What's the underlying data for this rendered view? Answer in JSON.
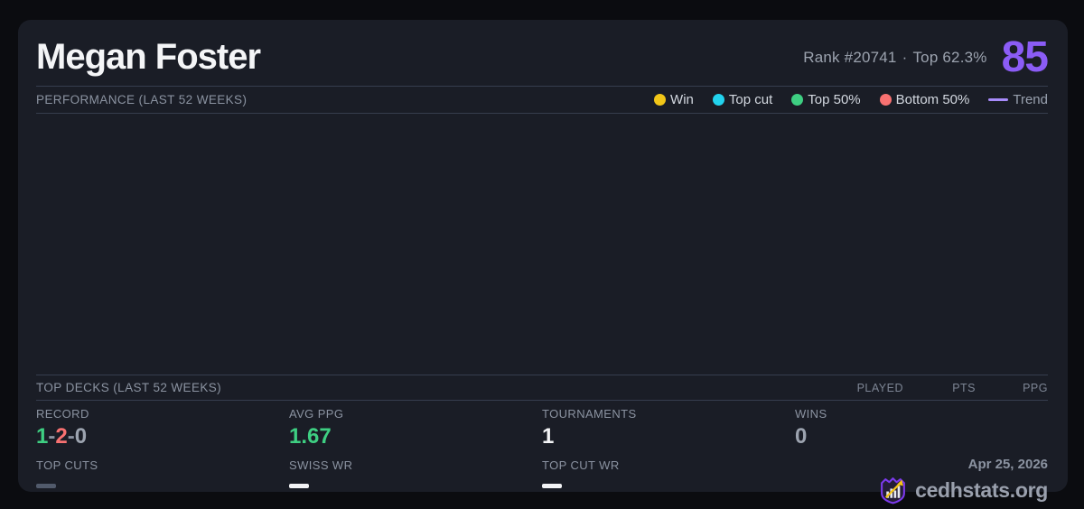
{
  "colors": {
    "page_bg": "#0b0c10",
    "card_bg": "#1a1d26",
    "divider": "#363d4e",
    "title_white": "#f4f5f7",
    "muted_grey": "#8b93a1",
    "score_purple": "#8b5cf6",
    "win_yellow": "#f2c618",
    "top_cut_cyan": "#22d3ee",
    "top50_green": "#3ecf82",
    "bottom50_red": "#f87171",
    "trend_purple": "#a78bfa",
    "value_grey": "#9ca3af",
    "logo_purple": "#7c3aed",
    "logo_gold": "#f5c518"
  },
  "header": {
    "player_name": "Megan Foster",
    "rank_text": "Rank #20741",
    "separator": "·",
    "percentile_text": "Top 62.3%",
    "score": "85"
  },
  "performance": {
    "title": "PERFORMANCE (LAST 52 WEEKS)",
    "legend": [
      {
        "label": "Win",
        "color": "#f2c618",
        "marker": "dot"
      },
      {
        "label": "Top cut",
        "color": "#22d3ee",
        "marker": "dot"
      },
      {
        "label": "Top 50%",
        "color": "#3ecf82",
        "marker": "dot"
      },
      {
        "label": "Bottom 50%",
        "color": "#f87171",
        "marker": "dot"
      },
      {
        "label": "Trend",
        "color": "#a78bfa",
        "marker": "line"
      }
    ],
    "chart_empty": true
  },
  "top_decks": {
    "title": "TOP DECKS (LAST 52 WEEKS)",
    "columns": [
      "PLAYED",
      "PTS",
      "PPG"
    ],
    "rows": []
  },
  "stats": {
    "record": {
      "label": "RECORD",
      "wins": "1",
      "losses": "2",
      "draws": "0",
      "separator": "-"
    },
    "avg_ppg": {
      "label": "AVG PPG",
      "value": "1.67"
    },
    "tournaments": {
      "label": "TOURNAMENTS",
      "value": "1"
    },
    "wins": {
      "label": "WINS",
      "value": "0"
    },
    "top_cuts": {
      "label": "TOP CUTS",
      "value": ""
    },
    "swiss_wr": {
      "label": "SWISS WR",
      "value": ""
    },
    "top_cut_wr": {
      "label": "TOP CUT WR",
      "value": ""
    }
  },
  "footer": {
    "date": "Apr 25, 2026",
    "brand": "cedhstats.org"
  }
}
